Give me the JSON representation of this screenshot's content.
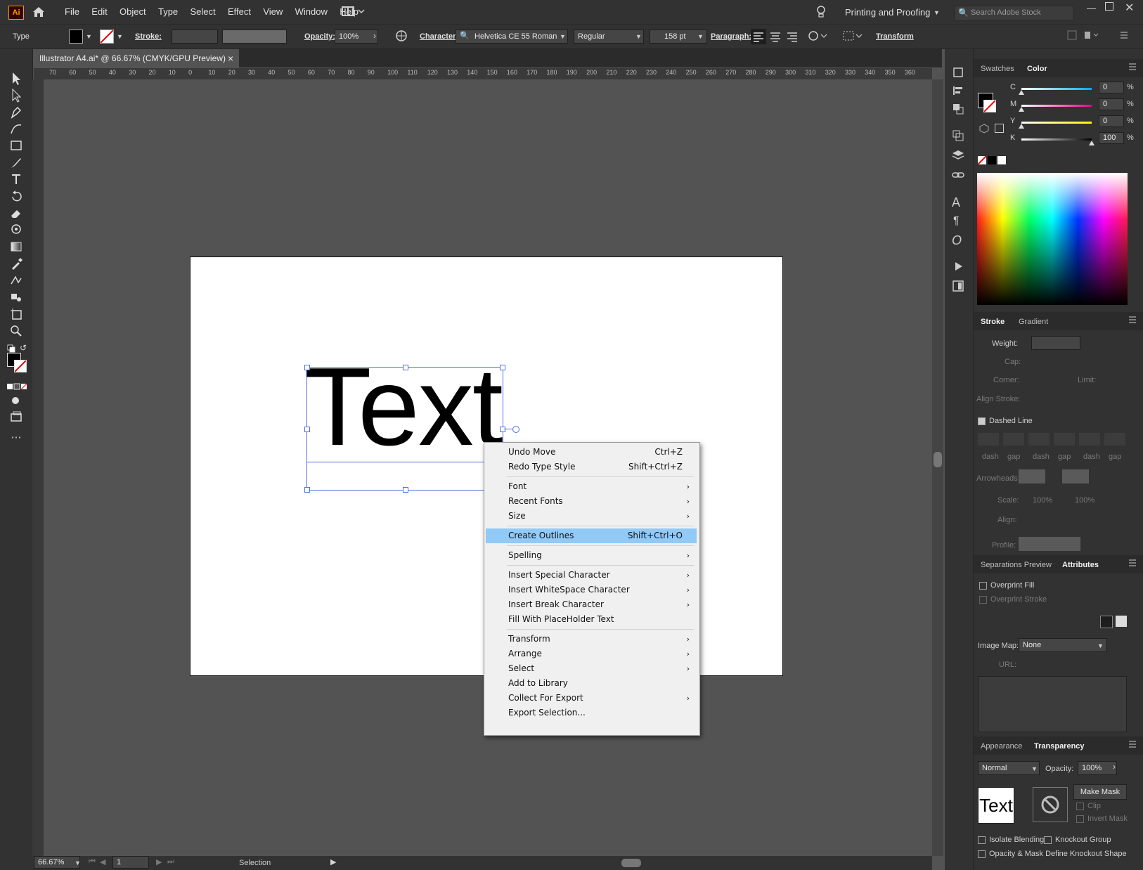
{
  "app": {
    "logo": "Ai"
  },
  "menu": [
    "File",
    "Edit",
    "Object",
    "Type",
    "Select",
    "Effect",
    "View",
    "Window",
    "Help"
  ],
  "workspace": "Printing and Proofing",
  "search": {
    "placeholder": "Search Adobe Stock"
  },
  "control": {
    "type_label": "Type",
    "stroke_label": "Stroke:",
    "opacity_label": "Opacity:",
    "opacity_value": "100%",
    "character_label": "Character:",
    "font_family": "Helvetica CE 55 Roman",
    "font_style": "Regular",
    "font_size": "158 pt",
    "paragraph_label": "Paragraph:",
    "transform_label": "Transform"
  },
  "document": {
    "tab_title": "Illustrator A4.ai* @ 66.67% (CMYK/GPU Preview)",
    "close": "×",
    "text_content": "Text"
  },
  "ruler_h": [
    "70",
    "60",
    "50",
    "40",
    "30",
    "20",
    "10",
    "0",
    "10",
    "20",
    "30",
    "40",
    "50",
    "60",
    "70",
    "80",
    "90",
    "100",
    "110",
    "120",
    "130",
    "140",
    "150",
    "160",
    "170",
    "180",
    "190",
    "200",
    "210",
    "220",
    "230",
    "240",
    "250",
    "260",
    "270",
    "280",
    "290",
    "300",
    "310",
    "320",
    "330",
    "340",
    "350",
    "360"
  ],
  "context_menu": [
    {
      "label": "Undo Move",
      "shortcut": "Ctrl+Z",
      "sub": false
    },
    {
      "label": "Redo Type Style",
      "shortcut": "Shift+Ctrl+Z",
      "sub": false
    },
    {
      "label": "Font",
      "shortcut": "",
      "sub": true
    },
    {
      "label": "Recent Fonts",
      "shortcut": "",
      "sub": true
    },
    {
      "label": "Size",
      "shortcut": "",
      "sub": true
    },
    {
      "label": "Create Outlines",
      "shortcut": "Shift+Ctrl+O",
      "sub": false,
      "highlight": true
    },
    {
      "label": "Spelling",
      "shortcut": "",
      "sub": true
    },
    {
      "label": "Insert Special Character",
      "shortcut": "",
      "sub": true
    },
    {
      "label": "Insert WhiteSpace Character",
      "shortcut": "",
      "sub": true
    },
    {
      "label": "Insert Break Character",
      "shortcut": "",
      "sub": true
    },
    {
      "label": "Fill With PlaceHolder Text",
      "shortcut": "",
      "sub": false
    },
    {
      "label": "Transform",
      "shortcut": "",
      "sub": true
    },
    {
      "label": "Arrange",
      "shortcut": "",
      "sub": true
    },
    {
      "label": "Select",
      "shortcut": "",
      "sub": true
    },
    {
      "label": "Add to Library",
      "shortcut": "",
      "sub": false
    },
    {
      "label": "Collect For Export",
      "shortcut": "",
      "sub": true
    },
    {
      "label": "Export Selection...",
      "shortcut": "",
      "sub": false
    }
  ],
  "panels": {
    "swatches_tab": "Swatches",
    "color_tab": "Color",
    "cmyk": [
      {
        "ch": "C",
        "val": "0"
      },
      {
        "ch": "M",
        "val": "0"
      },
      {
        "ch": "Y",
        "val": "0"
      },
      {
        "ch": "K",
        "val": "100"
      }
    ],
    "percent": "%",
    "stroke_tab": "Stroke",
    "gradient_tab": "Gradient",
    "weight_label": "Weight:",
    "cap_label": "Cap:",
    "corner_label": "Corner:",
    "limit_label": "Limit:",
    "align_stroke_label": "Align Stroke:",
    "dashed_line": "Dashed Line",
    "dash_labels": [
      "dash",
      "gap",
      "dash",
      "gap",
      "dash",
      "gap"
    ],
    "arrowheads_label": "Arrowheads:",
    "scale_label": "Scale:",
    "scale_values": [
      "100%",
      "100%"
    ],
    "align_label": "Align:",
    "profile_label": "Profile:",
    "separations_tab": "Separations Preview",
    "attributes_tab": "Attributes",
    "overprint_fill": "Overprint Fill",
    "overprint_stroke": "Overprint Stroke",
    "image_map_label": "Image Map:",
    "image_map_value": "None",
    "url_label": "URL:",
    "appearance_tab": "Appearance",
    "transparency_tab": "Transparency",
    "blend_mode": "Normal",
    "opacity_label": "Opacity:",
    "opacity_value": "100%",
    "thumb_text": "Text",
    "make_mask": "Make Mask",
    "clip": "Clip",
    "invert_mask": "Invert Mask",
    "isolate_blending": "Isolate Blending",
    "knockout_group": "Knockout Group",
    "opacity_mask_knockout": "Opacity & Mask Define Knockout Shape"
  },
  "status": {
    "zoom": "66.67%",
    "artboard": "1",
    "tool": "Selection"
  }
}
